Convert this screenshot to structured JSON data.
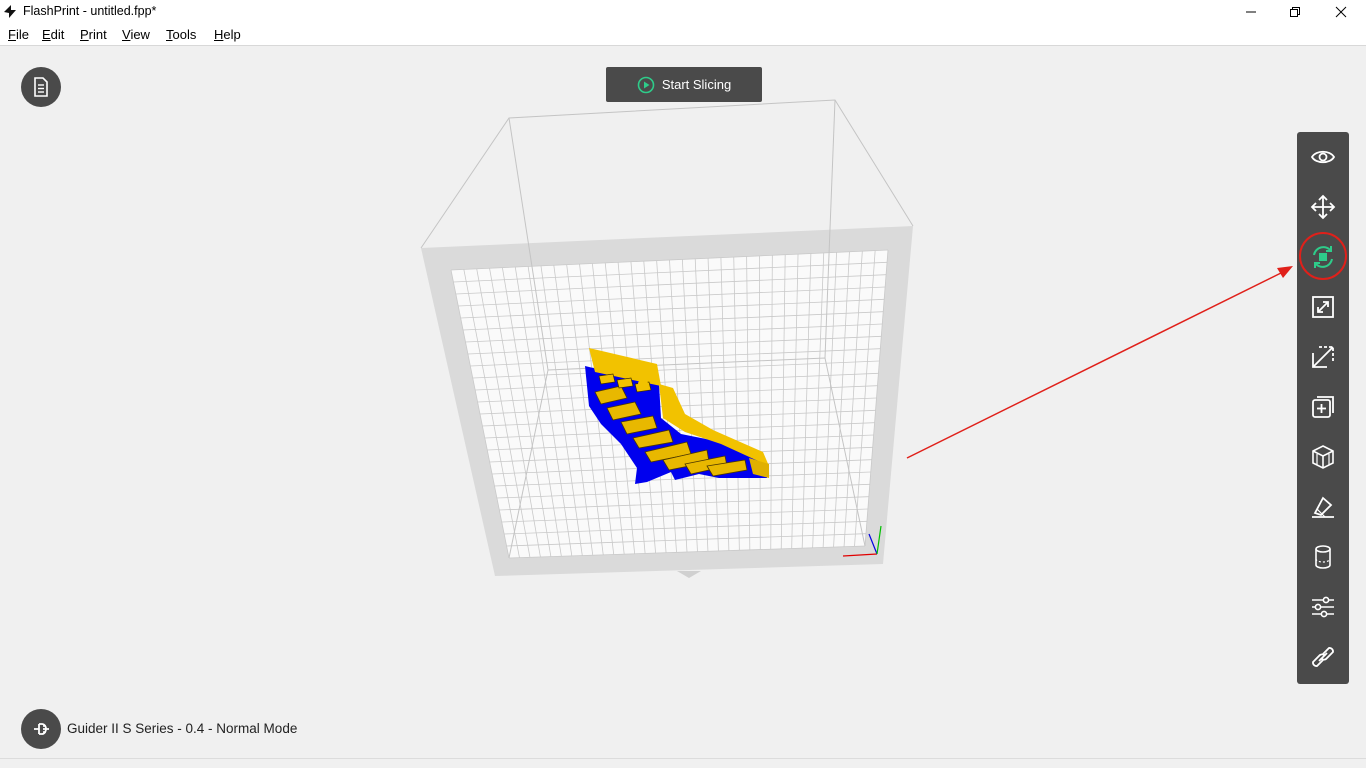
{
  "window": {
    "title": "FlashPrint - untitled.fpp*",
    "controls": [
      "minimize",
      "restore",
      "close"
    ]
  },
  "menu": {
    "items": [
      {
        "label": "File",
        "mnemonic": "F",
        "rest": "ile"
      },
      {
        "label": "Edit",
        "mnemonic": "E",
        "rest": "dit"
      },
      {
        "label": "Print",
        "mnemonic": "P",
        "rest": "rint"
      },
      {
        "label": "View",
        "mnemonic": "V",
        "rest": "iew"
      },
      {
        "label": "Tools",
        "mnemonic": "T",
        "rest": "ools"
      },
      {
        "label": "Help",
        "mnemonic": "H",
        "rest": "elp"
      }
    ]
  },
  "viewport": {
    "slice_button_label": "Start Slicing",
    "status_text": "Guider II S Series - 0.4 - Normal Mode",
    "model_colors": {
      "primary": "#0000ee",
      "secondary": "#f2c200"
    }
  },
  "toolbar": {
    "items": [
      {
        "name": "view",
        "icon": "eye-icon"
      },
      {
        "name": "move",
        "icon": "move-arrows-icon"
      },
      {
        "name": "rotate",
        "icon": "rotate-icon",
        "active": true
      },
      {
        "name": "scale",
        "icon": "scale-icon"
      },
      {
        "name": "cut",
        "icon": "cut-icon"
      },
      {
        "name": "add",
        "icon": "add-object-icon"
      },
      {
        "name": "supports",
        "icon": "supports-icon"
      },
      {
        "name": "lay-flat",
        "icon": "lay-flat-icon"
      },
      {
        "name": "extruder",
        "icon": "cylinder-icon"
      },
      {
        "name": "settings",
        "icon": "sliders-icon"
      },
      {
        "name": "connect",
        "icon": "link-icon"
      }
    ]
  },
  "annotation": {
    "color": "#e0201a"
  },
  "colors": {
    "accent": "#2ecc8a",
    "toolbar_bg": "#4a4a4a"
  }
}
